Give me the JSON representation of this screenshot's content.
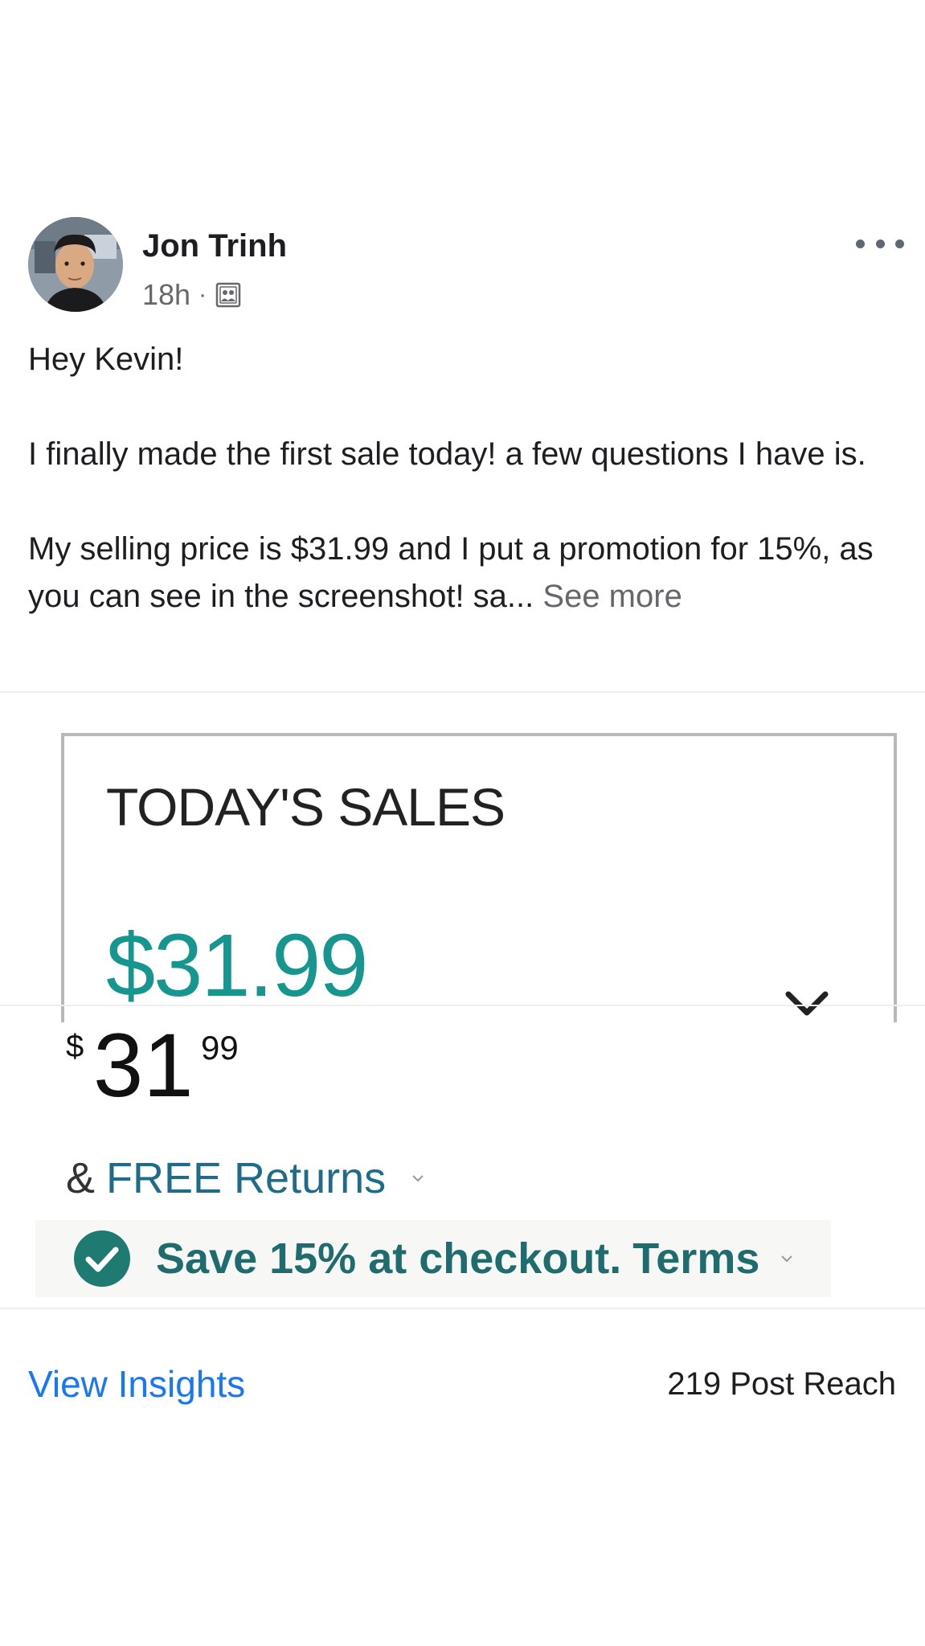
{
  "post": {
    "author": "Jon Trinh",
    "time": "18h",
    "separator": "·",
    "audience_icon": "public-group-icon",
    "more_icon": "more-horizontal-icon",
    "body": {
      "greeting": "Hey Kevin!",
      "paragraph_1": "I finally made the first sale today! a few questions I have is.",
      "paragraph_2": "My selling price is $31.99 and I put a promotion for 15%, as you can see in the screenshot! sa...",
      "see_more": "See more"
    }
  },
  "attachment": {
    "sales_card": {
      "title": "TODAY'S SALES",
      "value": "$31.99",
      "chevron_icon": "chevron-down-icon"
    },
    "price": {
      "currency": "$",
      "whole": "31",
      "fraction": "99"
    },
    "returns": {
      "prefix": "&",
      "link": "FREE Returns",
      "chevron_icon": "chevron-down-icon"
    },
    "savings": {
      "icon": "checkmark-circle-icon",
      "text": "Save 15% at checkout.",
      "terms": "Terms",
      "chevron_icon": "chevron-down-icon"
    }
  },
  "footer": {
    "insights": "View Insights",
    "reach": "219 Post Reach"
  },
  "colors": {
    "link_blue": "#1877f2",
    "secondary_text": "#65676b",
    "sales_teal": "#17958f",
    "savings_green": "#1f7a72",
    "amazon_link": "#1f6c8a"
  }
}
